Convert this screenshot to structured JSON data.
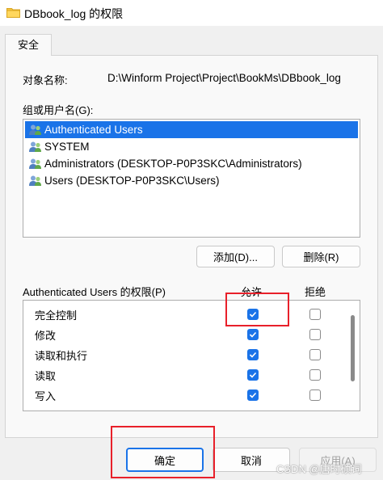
{
  "window": {
    "title": "DBbook_log 的权限"
  },
  "tabs": [
    {
      "label": "安全",
      "active": true
    }
  ],
  "object": {
    "label": "对象名称:",
    "value": "D:\\Winform Project\\Project\\BookMs\\DBbook_log"
  },
  "groups": {
    "label": "组或用户名(G):",
    "items": [
      {
        "name": "Authenticated Users",
        "selected": true
      },
      {
        "name": "SYSTEM",
        "selected": false
      },
      {
        "name": "Administrators (DESKTOP-P0P3SKC\\Administrators)",
        "selected": false
      },
      {
        "name": "Users (DESKTOP-P0P3SKC\\Users)",
        "selected": false
      }
    ],
    "add_label": "添加(D)...",
    "remove_label": "删除(R)"
  },
  "permissions": {
    "label": "Authenticated Users 的权限(P)",
    "allow_header": "允许",
    "deny_header": "拒绝",
    "rows": [
      {
        "name": "完全控制",
        "allow": true,
        "deny": false
      },
      {
        "name": "修改",
        "allow": true,
        "deny": false
      },
      {
        "name": "读取和执行",
        "allow": true,
        "deny": false
      },
      {
        "name": "读取",
        "allow": true,
        "deny": false
      },
      {
        "name": "写入",
        "allow": true,
        "deny": false
      }
    ]
  },
  "footer": {
    "ok_label": "确定",
    "cancel_label": "取消",
    "apply_label": "应用(A)"
  },
  "watermark": "CSDN @唐时硕词",
  "colors": {
    "accent": "#1a73e8",
    "highlight_box": "#e8202a"
  }
}
